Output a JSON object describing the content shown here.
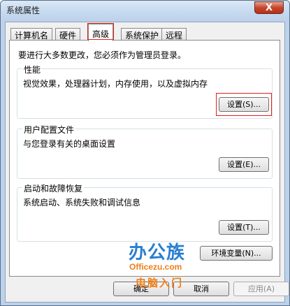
{
  "window": {
    "title": "系统属性",
    "close_label": "X"
  },
  "tabs": [
    {
      "label": "计算机名"
    },
    {
      "label": "硬件"
    },
    {
      "label": "高级",
      "active": true
    },
    {
      "label": "系统保护"
    },
    {
      "label": "远程"
    }
  ],
  "admin_note": "要进行大多数更改，您必须作为管理员登录。",
  "groups": {
    "performance": {
      "title": "性能",
      "description": "视觉效果，处理器计划，内存使用，以及虚拟内存",
      "button": "设置(S)..."
    },
    "user_profiles": {
      "title": "用户配置文件",
      "description": "与您登录有关的桌面设置",
      "button": "设置(E)..."
    },
    "startup_recovery": {
      "title": "启动和故障恢复",
      "description": "系统启动、系统失败和调试信息",
      "button": "设置(T)..."
    }
  },
  "env_button": "环境变量(N)...",
  "footer": {
    "ok": "确定",
    "cancel": "取消",
    "apply": "应用(A)"
  },
  "watermark": {
    "logo": "办公族",
    "url": "Officezu.com",
    "subtitle": "电脑入门"
  },
  "colors": {
    "highlight": "#e0201a",
    "watermark_blue": "#2a7fd0",
    "watermark_orange": "#ef7f18"
  }
}
